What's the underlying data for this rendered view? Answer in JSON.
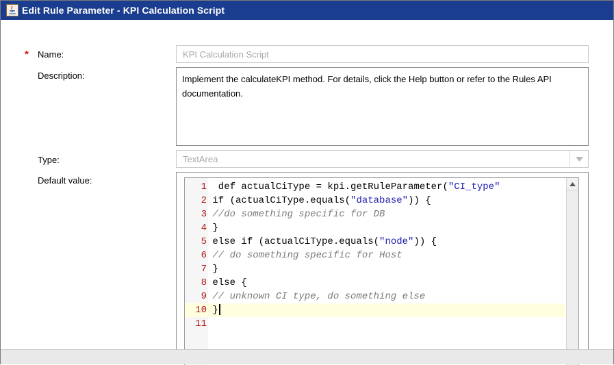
{
  "window": {
    "title": "Edit Rule Parameter - KPI Calculation Script"
  },
  "form": {
    "required_marker": "*",
    "name_label": "Name:",
    "name_value": "KPI Calculation Script",
    "description_label": "Description:",
    "description_value": "Implement the calculateKPI method. For details, click the Help button or refer to the Rules API documentation.",
    "type_label": "Type:",
    "type_value": "TextArea",
    "default_value_label": "Default value:"
  },
  "editor": {
    "current_line": 10,
    "lines": [
      {
        "num": "1",
        "segments": [
          {
            "t": " def actualCiType = kpi.getRuleParameter(",
            "c": "code"
          },
          {
            "t": "\"CI_type\"",
            "c": "str"
          }
        ]
      },
      {
        "num": "2",
        "segments": [
          {
            "t": "if (actualCiType.equals(",
            "c": "code"
          },
          {
            "t": "\"database\"",
            "c": "str"
          },
          {
            "t": ")) {",
            "c": "code"
          }
        ]
      },
      {
        "num": "3",
        "segments": [
          {
            "t": "//do something specific for DB",
            "c": "comment"
          }
        ]
      },
      {
        "num": "4",
        "segments": [
          {
            "t": "}",
            "c": "code"
          }
        ]
      },
      {
        "num": "5",
        "segments": [
          {
            "t": "else if (actualCiType.equals(",
            "c": "code"
          },
          {
            "t": "\"node\"",
            "c": "str"
          },
          {
            "t": ")) {",
            "c": "code"
          }
        ]
      },
      {
        "num": "6",
        "segments": [
          {
            "t": "// do something specific for Host",
            "c": "comment"
          }
        ]
      },
      {
        "num": "7",
        "segments": [
          {
            "t": "}",
            "c": "code"
          }
        ]
      },
      {
        "num": "8",
        "segments": [
          {
            "t": "else {",
            "c": "code"
          }
        ]
      },
      {
        "num": "9",
        "segments": [
          {
            "t": "// unknown CI type, do something else",
            "c": "comment"
          }
        ]
      },
      {
        "num": "10",
        "segments": [
          {
            "t": "}",
            "c": "code"
          }
        ]
      },
      {
        "num": "11",
        "segments": []
      }
    ]
  },
  "icons": {
    "app": "java-app-icon",
    "dropdown": "chevron-down-icon",
    "scroll_up": "scroll-up-arrow-icon"
  },
  "colors": {
    "titlebar": "#1b3d8f",
    "required": "#e01010",
    "line_number": "#b01a1a",
    "string": "#1a1ab0",
    "comment": "#7a7a7a",
    "current_line": "#ffffe0"
  }
}
